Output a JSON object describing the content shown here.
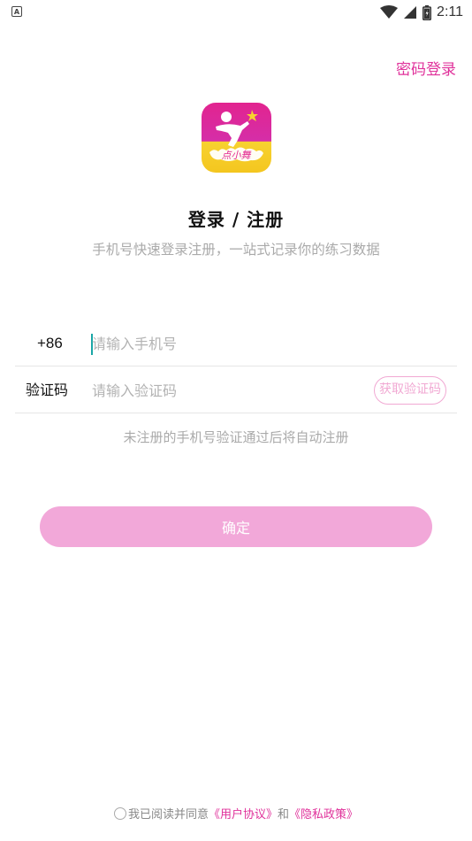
{
  "status_bar": {
    "notification_letter": "A",
    "time": "2:11",
    "icons": [
      "wifi-icon",
      "signal-icon",
      "battery-icon"
    ]
  },
  "header": {
    "password_login": "密码登录"
  },
  "logo": {
    "name": "app-logo",
    "brand_text": "点小舞",
    "colors": {
      "top": "#e2248f",
      "bottom": "#f7d230"
    }
  },
  "title": "登录 / 注册",
  "subtitle": "手机号快速登录注册，一站式记录你的练习数据",
  "phone": {
    "prefix": "+86",
    "placeholder": "请输入手机号",
    "value": ""
  },
  "code": {
    "label": "验证码",
    "placeholder": "请输入验证码",
    "value": "",
    "get_code_label": "获取验证码"
  },
  "hint": "未注册的手机号验证通过后将自动注册",
  "confirm_label": "确定",
  "agreement": {
    "checked": false,
    "prefix": "我已阅读并同意",
    "user_agreement": "《用户协议》",
    "and": "和",
    "privacy_policy": "《隐私政策》"
  },
  "colors": {
    "accent": "#e0329b",
    "button_bg": "#f2a8d9",
    "get_code_border": "#f1a9d3",
    "placeholder": "#b3b3b3"
  }
}
